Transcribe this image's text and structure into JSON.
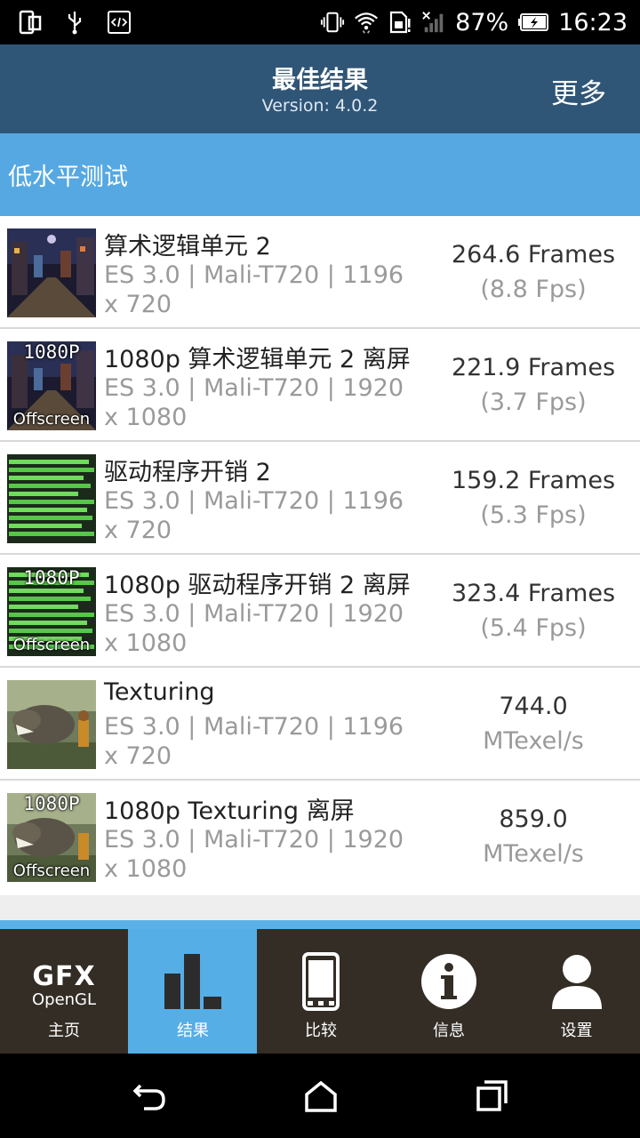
{
  "status_bar": {
    "battery": "87%",
    "time": "16:23"
  },
  "header": {
    "title": "最佳结果",
    "version": "Version: 4.0.2",
    "more": "更多"
  },
  "section": {
    "title": "低水平测试"
  },
  "results": [
    {
      "title": "算术逻辑单元 2",
      "subtitle": "ES 3.0 | Mali-T720 | 1196 x 720",
      "score": "264.6 Frames",
      "unit": "(8.8 Fps)",
      "thumb": "city",
      "badge_top": "",
      "badge_bottom": ""
    },
    {
      "title": "1080p 算术逻辑单元 2 离屏",
      "subtitle": "ES 3.0 | Mali-T720 | 1920 x 1080",
      "score": "221.9 Frames",
      "unit": "(3.7 Fps)",
      "thumb": "city",
      "badge_top": "1080P",
      "badge_bottom": "Offscreen"
    },
    {
      "title": "驱动程序开销 2",
      "subtitle": "ES 3.0 | Mali-T720 | 1196 x 720",
      "score": "159.2 Frames",
      "unit": "(5.3 Fps)",
      "thumb": "bars",
      "badge_top": "",
      "badge_bottom": ""
    },
    {
      "title": "1080p 驱动程序开销 2 离屏",
      "subtitle": "ES 3.0 | Mali-T720 | 1920 x 1080",
      "score": "323.4 Frames",
      "unit": "(5.4 Fps)",
      "thumb": "bars",
      "badge_top": "1080P",
      "badge_bottom": "Offscreen"
    },
    {
      "title": "Texturing",
      "subtitle": "ES 3.0 | Mali-T720 | 1196 x 720",
      "score": "744.0",
      "unit": "MTexel/s",
      "thumb": "dino",
      "badge_top": "",
      "badge_bottom": ""
    },
    {
      "title": "1080p Texturing 离屏",
      "subtitle": "ES 3.0 | Mali-T720 | 1920 x 1080",
      "score": "859.0",
      "unit": "MTexel/s",
      "thumb": "dino",
      "badge_top": "1080P",
      "badge_bottom": "Offscreen"
    }
  ],
  "bottom_nav": {
    "logo_top": "GFX",
    "logo_bottom": "OpenGL",
    "tabs": [
      {
        "label": "主页",
        "icon": "gfx-logo-icon",
        "active": false
      },
      {
        "label": "结果",
        "icon": "bar-chart-icon",
        "active": true
      },
      {
        "label": "比较",
        "icon": "phone-icon",
        "active": false
      },
      {
        "label": "信息",
        "icon": "info-icon",
        "active": false
      },
      {
        "label": "设置",
        "icon": "user-icon",
        "active": false
      }
    ]
  },
  "colors": {
    "header_bg": "#2f5577",
    "section_bg": "#56a8e2",
    "nav_bg": "#332d26",
    "nav_active": "#56aee6"
  }
}
